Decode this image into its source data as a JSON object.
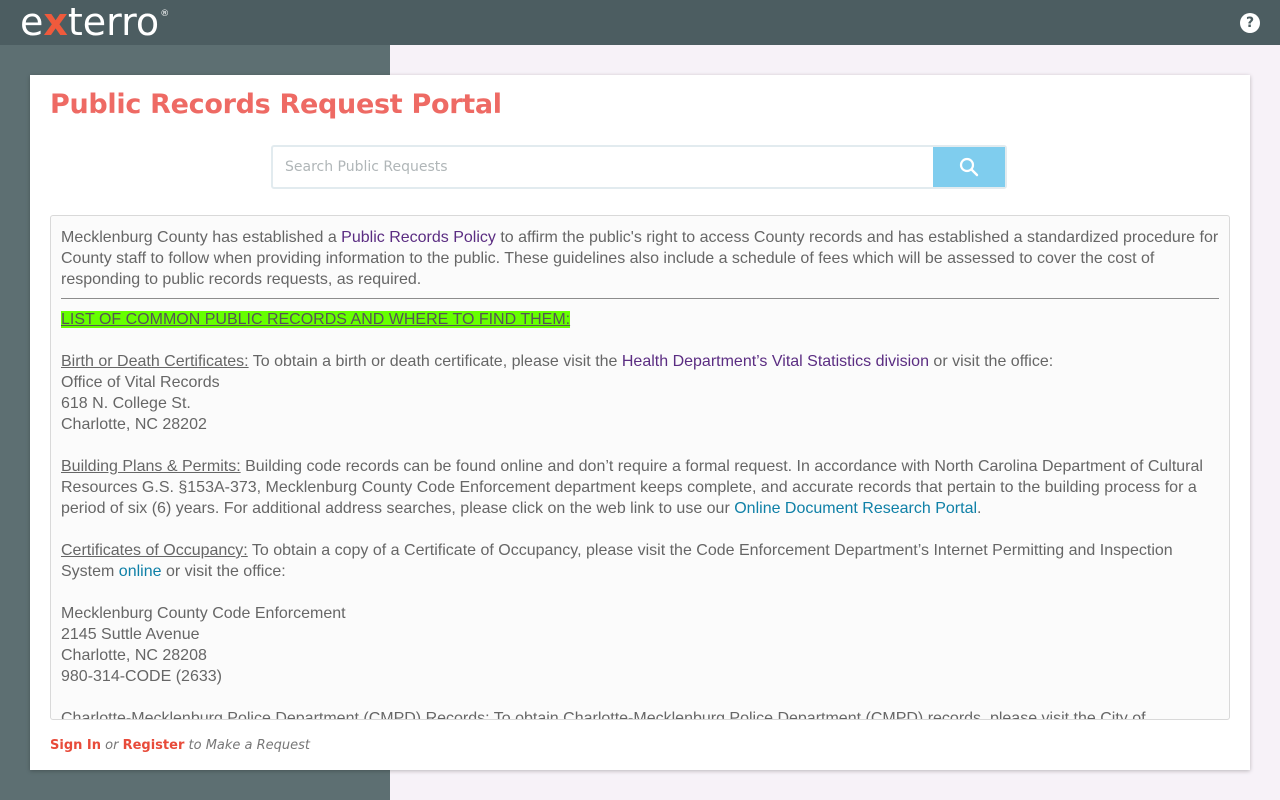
{
  "header": {
    "logo": {
      "part1": "e",
      "part2": "x",
      "part3": "terro",
      "reg": "®"
    },
    "help_label": "?"
  },
  "page": {
    "title": "Public Records Request Portal",
    "search": {
      "placeholder": "Search Public Requests",
      "value": "",
      "icon": "search-icon"
    }
  },
  "content": {
    "intro": {
      "before": "Mecklenburg County has established a ",
      "link": "Public Records Policy",
      "after": " to affirm the public's right to access County records and has established a standardized procedure for County staff to follow when providing information to the public. These guidelines also include a schedule of fees which will be assessed to cover the cost of responding to public records requests, as required."
    },
    "list_heading": "LIST OF COMMON PUBLIC RECORDS AND WHERE TO FIND THEM:",
    "birth": {
      "label": "Birth or Death Certificates:",
      "before": " To obtain a birth or death certificate, please visit the ",
      "link": "Health Department’s Vital Statistics division",
      "after": " or visit the office:",
      "address": [
        "Office of Vital Records",
        "618 N. College St.",
        "Charlotte, NC 28202"
      ]
    },
    "building": {
      "label": "Building Plans & Permits:",
      "before": " Building code records can be found online and don’t require a formal request. In accordance with North Carolina Department of Cultural Resources G.S. §153A-373, Mecklenburg County Code Enforcement department keeps complete, and accurate records that pertain to the building process for a period of six (6) years. For additional address searches, please click on the web link to use our ",
      "link": "Online Document Research Portal",
      "after": "."
    },
    "occupancy": {
      "label": "Certificates of Occupancy:",
      "before": " To obtain a copy of a Certificate of Occupancy, please visit the Code Enforcement Department’s Internet Permitting and Inspection System ",
      "link": "online",
      "after": " or visit the office:",
      "address": [
        "Mecklenburg County Code Enforcement",
        "2145 Suttle Avenue",
        "Charlotte, NC 28208",
        "980-314-CODE (2633)"
      ]
    },
    "cmpd": {
      "label": "Charlotte-Mecklenburg Police Department (CMPD) Records:",
      "before": " To obtain Charlotte-Mecklenburg Police Department (CMPD) records, please visit the City of"
    }
  },
  "footer": {
    "sign_in": "Sign In",
    "or": "or",
    "register": "Register",
    "suffix": "to Make a Request"
  },
  "colors": {
    "topbar": "#4c5d61",
    "left_panel": "#5d6f72",
    "title": "#ee6a64",
    "search_button": "#7fcdee",
    "highlight": "#66ff00",
    "footer_link": "#e84b3a"
  }
}
